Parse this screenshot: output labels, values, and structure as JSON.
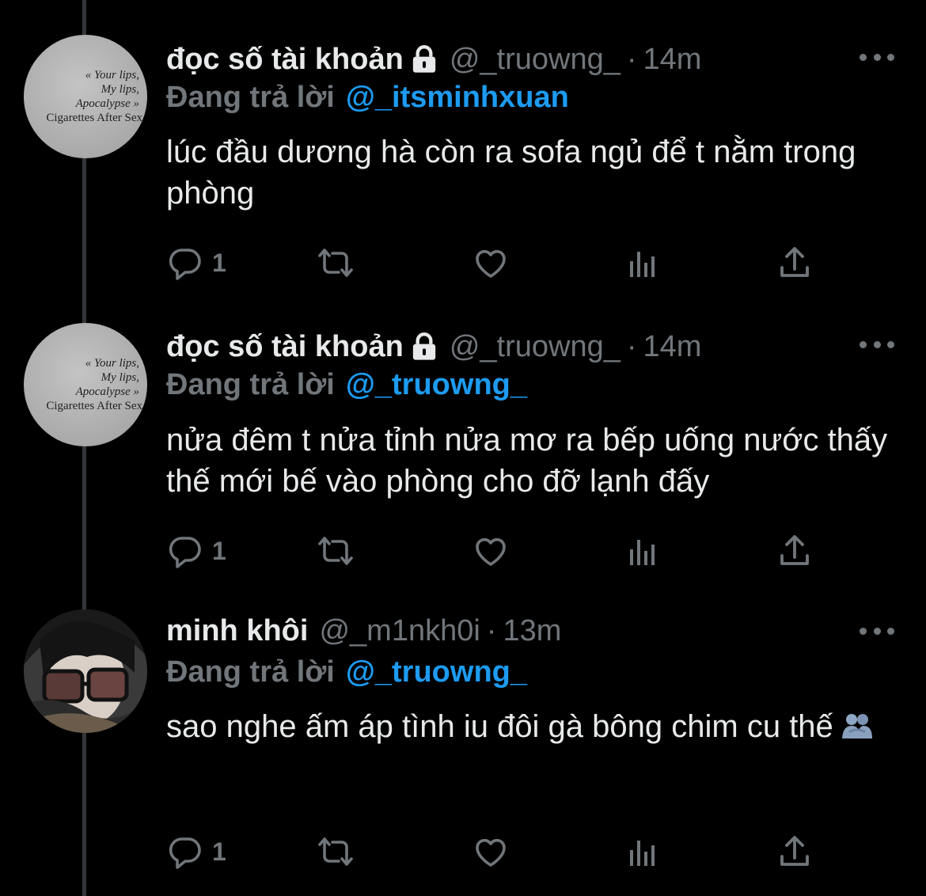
{
  "tweets": [
    {
      "name": "đọc số tài khoản",
      "locked": true,
      "handle": "@_truowng_",
      "dot": "·",
      "time": "14m",
      "replying_prefix": "Đang trả lời",
      "replying_to": "@_itsminhxuan",
      "text": "lúc đầu dương hà còn ra sofa ngủ để t nằm trong phòng",
      "reply_count": "1",
      "avatar_quote": [
        "« Your lips,",
        "My lips,",
        "Apocalypse »",
        "Cigarettes After Sex"
      ]
    },
    {
      "name": "đọc số tài khoản",
      "locked": true,
      "handle": "@_truowng_",
      "dot": "·",
      "time": "14m",
      "replying_prefix": "Đang trả lời",
      "replying_to": "@_truowng_",
      "text": "nửa đêm t nửa tỉnh nửa mơ ra bếp uống nước thấy thế mới bế vào phòng cho đỡ lạnh đấy",
      "reply_count": "1",
      "avatar_quote": [
        "« Your lips,",
        "My lips,",
        "Apocalypse »",
        "Cigarettes After Sex"
      ]
    },
    {
      "name": "minh khôi",
      "locked": false,
      "handle": "@_m1nkh0i",
      "dot": "·",
      "time": "13m",
      "replying_prefix": "Đang trả lời",
      "replying_to": "@_truowng_",
      "text": "sao nghe ấm áp tình iu đôi gà bông chim cu thế",
      "reply_count": "1",
      "emoji": "people-hugging"
    }
  ],
  "colors": {
    "background": "#000000",
    "text": "#e7e9ea",
    "muted": "#71767b",
    "link": "#1d9bf0",
    "thread_line": "#333639"
  },
  "icons": [
    "lock-icon",
    "more-icon",
    "reply-icon",
    "retweet-icon",
    "like-icon",
    "views-icon",
    "share-icon"
  ]
}
